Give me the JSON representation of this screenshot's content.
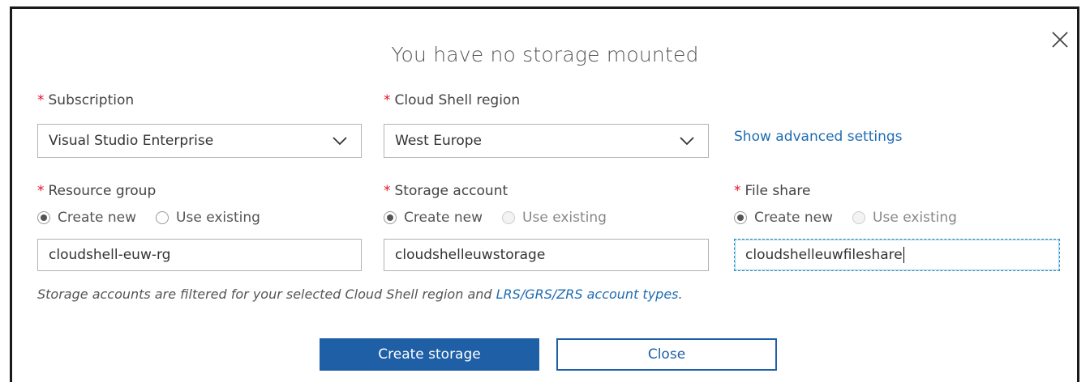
{
  "dialog": {
    "title": "You have no storage mounted",
    "close_icon": "close-icon"
  },
  "subscription": {
    "required_mark": "*",
    "label": "Subscription",
    "value": "Visual Studio Enterprise"
  },
  "region": {
    "required_mark": "*",
    "label": "Cloud Shell region",
    "value": "West Europe"
  },
  "advanced_link": "Show advanced settings",
  "resource_group": {
    "required_mark": "*",
    "label": "Resource group",
    "create_new": "Create new",
    "use_existing": "Use existing",
    "selected": "create_new",
    "value": "cloudshell-euw-rg"
  },
  "storage_account": {
    "required_mark": "*",
    "label": "Storage account",
    "create_new": "Create new",
    "use_existing": "Use existing",
    "selected": "create_new",
    "value": "cloudshelleuwstorage"
  },
  "file_share": {
    "required_mark": "*",
    "label": "File share",
    "create_new": "Create new",
    "use_existing": "Use existing",
    "selected": "create_new",
    "value": "cloudshelleuwfileshare"
  },
  "note": {
    "text": "Storage accounts are filtered for your selected Cloud Shell region and ",
    "link": "LRS/GRS/ZRS account types",
    "suffix": "."
  },
  "buttons": {
    "create": "Create storage",
    "close": "Close"
  },
  "colors": {
    "accent": "#1e5fa6",
    "link": "#1f6cb3",
    "required": "#e81123"
  }
}
